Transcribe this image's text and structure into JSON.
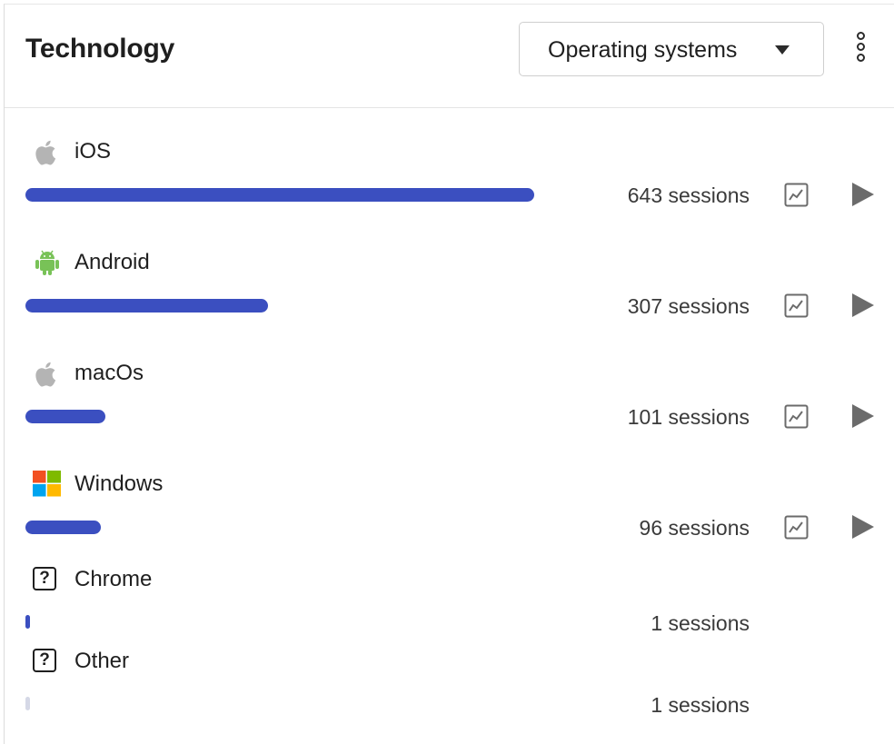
{
  "header": {
    "title": "Technology",
    "dropdown": {
      "selected": "Operating systems"
    }
  },
  "colors": {
    "bar_primary": "#3b4fc0",
    "bar_zero": "#d5d8e6",
    "android_green": "#78c257"
  },
  "items": [
    {
      "name": "iOS",
      "sessions": "643 sessions",
      "icon": "apple-icon",
      "share": 1.0
    },
    {
      "name": "Android",
      "sessions": "307 sessions",
      "icon": "android-icon",
      "share": 0.477
    },
    {
      "name": "macOs",
      "sessions": "101 sessions",
      "icon": "apple-icon",
      "share": 0.157
    },
    {
      "name": "Windows",
      "sessions": "96 sessions",
      "icon": "windows-icon",
      "share": 0.149
    },
    {
      "name": "Chrome",
      "sessions": "1 sessions",
      "icon": "question-icon",
      "share": 0.0016
    },
    {
      "name": "Other",
      "sessions": "1 sessions",
      "icon": "question-icon",
      "share": 0.0016
    }
  ]
}
